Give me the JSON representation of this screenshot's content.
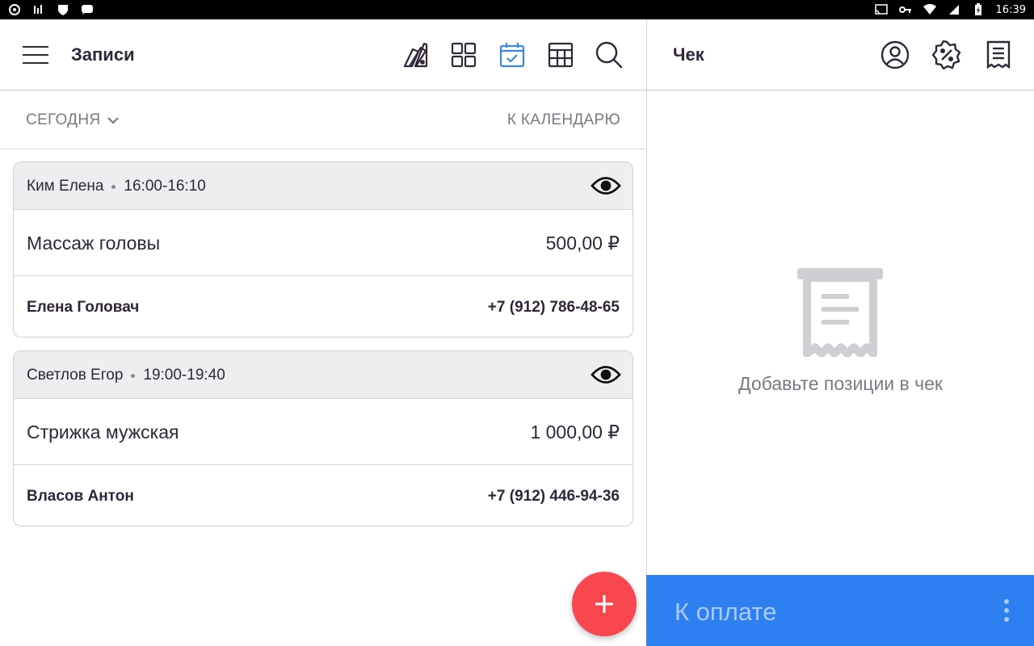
{
  "status_bar": {
    "time": "16:39"
  },
  "left": {
    "title": "Записи",
    "toolbar_icons": [
      "swatch-book-icon",
      "grid-icon",
      "calendar-check-icon",
      "table-icon",
      "search-icon"
    ],
    "filter": {
      "today_label": "СЕГОДНЯ",
      "calendar_link": "К КАЛЕНДАРЮ"
    },
    "appointments": [
      {
        "staff": "Ким Елена",
        "time": "16:00-16:10",
        "service": "Массаж головы",
        "price": "500,00 ₽",
        "client": "Елена Головач",
        "phone": "+7 (912) 786-48-65"
      },
      {
        "staff": "Светлов Егор",
        "time": "19:00-19:40",
        "service": "Стрижка мужская",
        "price": "1 000,00 ₽",
        "client": "Власов Антон",
        "phone": "+7 (912) 446-94-36"
      }
    ]
  },
  "right": {
    "title": "Чек",
    "toolbar_icons": [
      "user-circle-icon",
      "discount-badge-icon",
      "receipt-list-icon"
    ],
    "empty_text": "Добавьте позиции в чек",
    "pay_label": "К оплате"
  },
  "colors": {
    "accent": "#2e80f0",
    "fab": "#f8474f",
    "active_icon": "#3a86f0"
  }
}
